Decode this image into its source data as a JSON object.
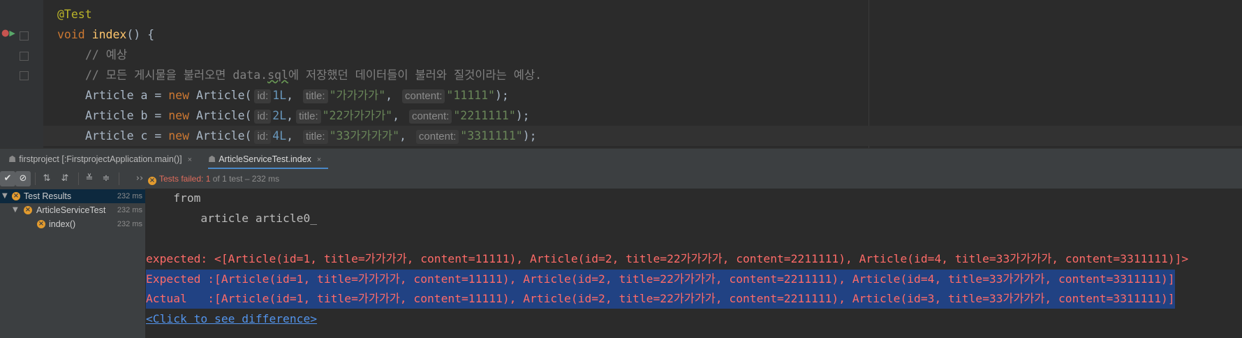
{
  "editor": {
    "lines": [
      {
        "segments": [
          {
            "t": "@Test",
            "c": "ann"
          }
        ]
      },
      {
        "segments": [
          {
            "t": "void ",
            "c": "kw"
          },
          {
            "t": "index",
            "c": "fn"
          },
          {
            "t": "() {",
            "c": "pl"
          }
        ]
      },
      {
        "segments": [
          {
            "t": "// 예상",
            "c": "cm"
          }
        ]
      },
      {
        "segments": [
          {
            "t": "// 모든 게시물을 불러오면 data.",
            "c": "cm"
          },
          {
            "t": "sql",
            "c": "cm squig"
          },
          {
            "t": "에 저장했던 데이터들이 불러와 질것이라는 예상.",
            "c": "cm"
          }
        ]
      },
      {
        "segments": [
          {
            "t": "Article a = ",
            "c": "pl"
          },
          {
            "t": "new ",
            "c": "kw"
          },
          {
            "t": "Article(",
            "c": "pl"
          },
          {
            "t": "id:",
            "c": "hint"
          },
          {
            "t": "1L",
            "c": "num"
          },
          {
            "t": ", ",
            "c": "pl"
          },
          {
            "t": "title:",
            "c": "hint"
          },
          {
            "t": "\"가가가가\"",
            "c": "str"
          },
          {
            "t": ", ",
            "c": "pl"
          },
          {
            "t": "content:",
            "c": "hint"
          },
          {
            "t": "\"11111\"",
            "c": "str"
          },
          {
            "t": ");",
            "c": "pl"
          }
        ]
      },
      {
        "segments": [
          {
            "t": "Article b = ",
            "c": "pl"
          },
          {
            "t": "new ",
            "c": "kw"
          },
          {
            "t": "Article(",
            "c": "pl"
          },
          {
            "t": "id:",
            "c": "hint"
          },
          {
            "t": "2L",
            "c": "num"
          },
          {
            "t": ",",
            "c": "pl"
          },
          {
            "t": "title:",
            "c": "hint"
          },
          {
            "t": "\"22가가가가\"",
            "c": "str"
          },
          {
            "t": ", ",
            "c": "pl"
          },
          {
            "t": "content:",
            "c": "hint"
          },
          {
            "t": "\"2211111\"",
            "c": "str"
          },
          {
            "t": ");",
            "c": "pl"
          }
        ]
      },
      {
        "segments": [
          {
            "t": "Article c = ",
            "c": "pl"
          },
          {
            "t": "new ",
            "c": "kw"
          },
          {
            "t": "Article(",
            "c": "pl"
          },
          {
            "t": "id:",
            "c": "hint"
          },
          {
            "t": "4L",
            "c": "num"
          },
          {
            "t": ", ",
            "c": "pl"
          },
          {
            "t": "title:",
            "c": "hint"
          },
          {
            "t": "\"33가가가가\"",
            "c": "str"
          },
          {
            "t": ", ",
            "c": "pl"
          },
          {
            "t": "content:",
            "c": "hint"
          },
          {
            "t": "\"3311111\"",
            "c": "str"
          },
          {
            "t": ");",
            "c": "pl"
          }
        ]
      }
    ]
  },
  "tabs": [
    {
      "label": "firstproject [:FirstprojectApplication.main()]",
      "close": "×"
    },
    {
      "label": "ArticleServiceTest.index",
      "close": "×"
    }
  ],
  "toolbar": {
    "status_prefix": "Tests failed:",
    "failed_count": "1",
    "status_rest": "of 1 test – 232 ms",
    "more": "››"
  },
  "tree": [
    {
      "label": "Test Results",
      "time": "232 ms"
    },
    {
      "label": "ArticleServiceTest",
      "time": "232 ms"
    },
    {
      "label": "index()",
      "time": "232 ms"
    }
  ],
  "console": {
    "lines": [
      {
        "text": "    from",
        "style": "plain"
      },
      {
        "text": "        article article0_",
        "style": "plain"
      },
      {
        "text": "",
        "style": "plain"
      },
      {
        "text": "expected: <[Article(id=1, title=가가가가, content=11111), Article(id=2, title=22가가가가, content=2211111), Article(id=4, title=33가가가가, content=3311111)]>",
        "style": "err"
      },
      {
        "text": "Expected :[Article(id=1, title=가가가가, content=11111), Article(id=2, title=22가가가가, content=2211111), Article(id=4, title=33가가가가, content=3311111)]",
        "style": "err hl"
      },
      {
        "text": "Actual   :[Article(id=1, title=가가가가, content=11111), Article(id=2, title=22가가가가, content=2211111), Article(id=3, title=33가가가가, content=3311111)]",
        "style": "err hl"
      },
      {
        "text": "<Click to see difference>",
        "style": "link"
      }
    ]
  },
  "colors": {
    "accent": "#4a88c7",
    "error": "#ff6b68",
    "selection": "#214283",
    "keyword": "#cc7832",
    "string": "#6a8759",
    "number": "#6897bb"
  }
}
